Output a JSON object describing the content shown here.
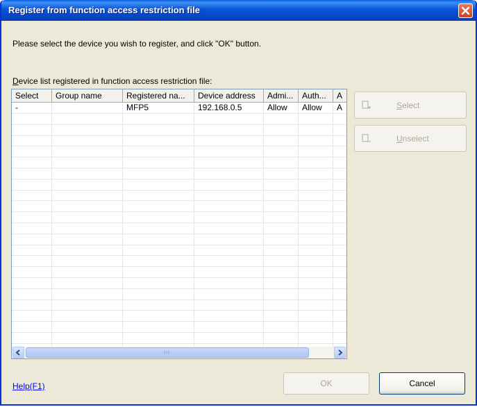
{
  "window": {
    "title": "Register from function access restriction file"
  },
  "instruction": "Please select the device you wish to register, and click \"OK\" button.",
  "list_label": {
    "mnemonic": "D",
    "rest": "evice list registered in function access restriction file:"
  },
  "table": {
    "columns": [
      "Select",
      "Group name",
      "Registered na...",
      "Device address",
      "Admi...",
      "Auth...",
      "A"
    ],
    "rows": [
      [
        "-",
        "",
        "MFP5",
        "192.168.0.5",
        "Allow",
        "Allow",
        "A"
      ]
    ],
    "empty_rows": 22
  },
  "side_buttons": {
    "select": {
      "mnemonic": "S",
      "rest": "elect"
    },
    "unselect": {
      "mnemonic": "U",
      "rest": "nselect"
    }
  },
  "footer": {
    "help": "Help(F1)",
    "ok": "OK",
    "cancel": "Cancel"
  },
  "icons": {
    "close": "close-icon",
    "scroll_left": "arrow-left-icon",
    "scroll_right": "arrow-right-icon"
  }
}
